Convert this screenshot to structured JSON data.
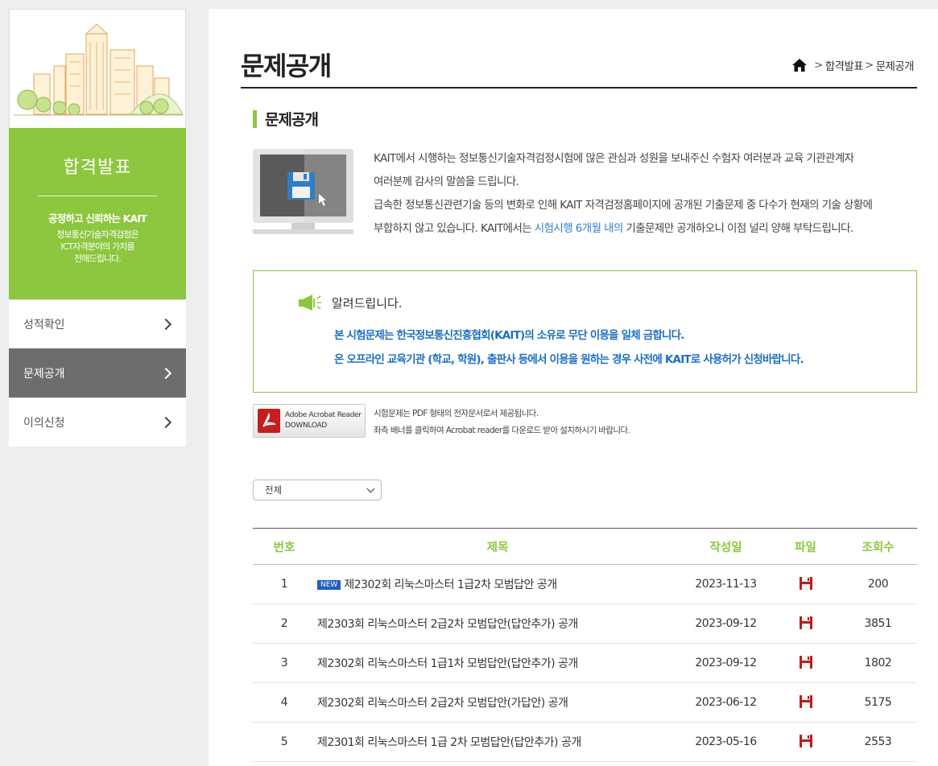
{
  "sidebar": {
    "hero_title": "합격발표",
    "slogan": "공정하고 신뢰하는 KAIT",
    "desc_line1": "정보통신기술자격검정은",
    "desc_line2": "ICT자격분야의 가치를",
    "desc_line3": "전해드립니다.",
    "menu": [
      {
        "label": "성적확인",
        "active": false
      },
      {
        "label": "문제공개",
        "active": true
      },
      {
        "label": "이의신청",
        "active": false
      }
    ]
  },
  "header": {
    "page_title": "문제공개",
    "breadcrumb": [
      "합격발표",
      "문제공개"
    ]
  },
  "section": {
    "title": "문제공개",
    "intro_line1": "KAIT에서 시행하는 정보통신기술자격검정시험에 많은 관심과 성원을 보내주신 수험자 여러분과 교육 기관관계자",
    "intro_line2": "여러분께 감사의 말씀을 드립니다.",
    "intro_line3": "급속한 정보통신관련기술 등의 변화로 인해 KAIT 자격검정홈페이지에 공개된 기출문제 중 다수가 현재의 기술 상황에",
    "intro_line4_pre": "부합하지 않고 있습니다. KAIT에서는 ",
    "intro_line4_hl": "시험시행 6개월 내의",
    "intro_line4_post": " 기출문제만 공개하오니 이점 널리 양해 부탁드립니다."
  },
  "notice": {
    "heading": "알려드립니다.",
    "line1": "본 시험문제는 한국정보통신진흥협회(KAIT)의 소유로 무단 이용을 일체 금합니다.",
    "line2": "온 오프라인 교육기관 (학교, 학원), 출판사 등에서 이용을 원하는 경우 사전에 KAIT로 사용허가 신청바랍니다."
  },
  "acrobat": {
    "line1": "Adobe Acrobat Reader",
    "line2": "DOWNLOAD"
  },
  "pdf_note": {
    "line1": "시험문제는 PDF 형태의 전자문서로서 제공됩니다.",
    "line2": "좌측 배너를 클릭하여 Acrobat reader를 다운로드 받아 설치하시기 바랍니다."
  },
  "filter": {
    "selected": "전체"
  },
  "board": {
    "headers": [
      "번호",
      "제목",
      "작성일",
      "파일",
      "조회수"
    ],
    "new_badge": "NEW",
    "rows": [
      {
        "no": "1",
        "title": "제2302회 리눅스마스터 1급2차 모범답안 공개",
        "date": "2023-11-13",
        "views": "200",
        "is_new": true
      },
      {
        "no": "2",
        "title": "제2303회 리눅스마스터 2급2차 모범답안(답안추가) 공개",
        "date": "2023-09-12",
        "views": "3851",
        "is_new": false
      },
      {
        "no": "3",
        "title": "제2302회 리눅스마스터 1급1차 모범답안(답안추가) 공개",
        "date": "2023-09-12",
        "views": "1802",
        "is_new": false
      },
      {
        "no": "4",
        "title": "제2302회 리눅스마스터 2급2차 모범답안(가답안) 공개",
        "date": "2023-06-12",
        "views": "5175",
        "is_new": false
      },
      {
        "no": "5",
        "title": "제2301회 리눅스마스터 1급 2차 모범답안(답안추가) 공개",
        "date": "2023-05-16",
        "views": "2553",
        "is_new": false
      }
    ]
  },
  "colors": {
    "accent_green": "#8dc63f",
    "link_blue": "#1d6fc0",
    "active_menu": "#6d6d6d"
  }
}
